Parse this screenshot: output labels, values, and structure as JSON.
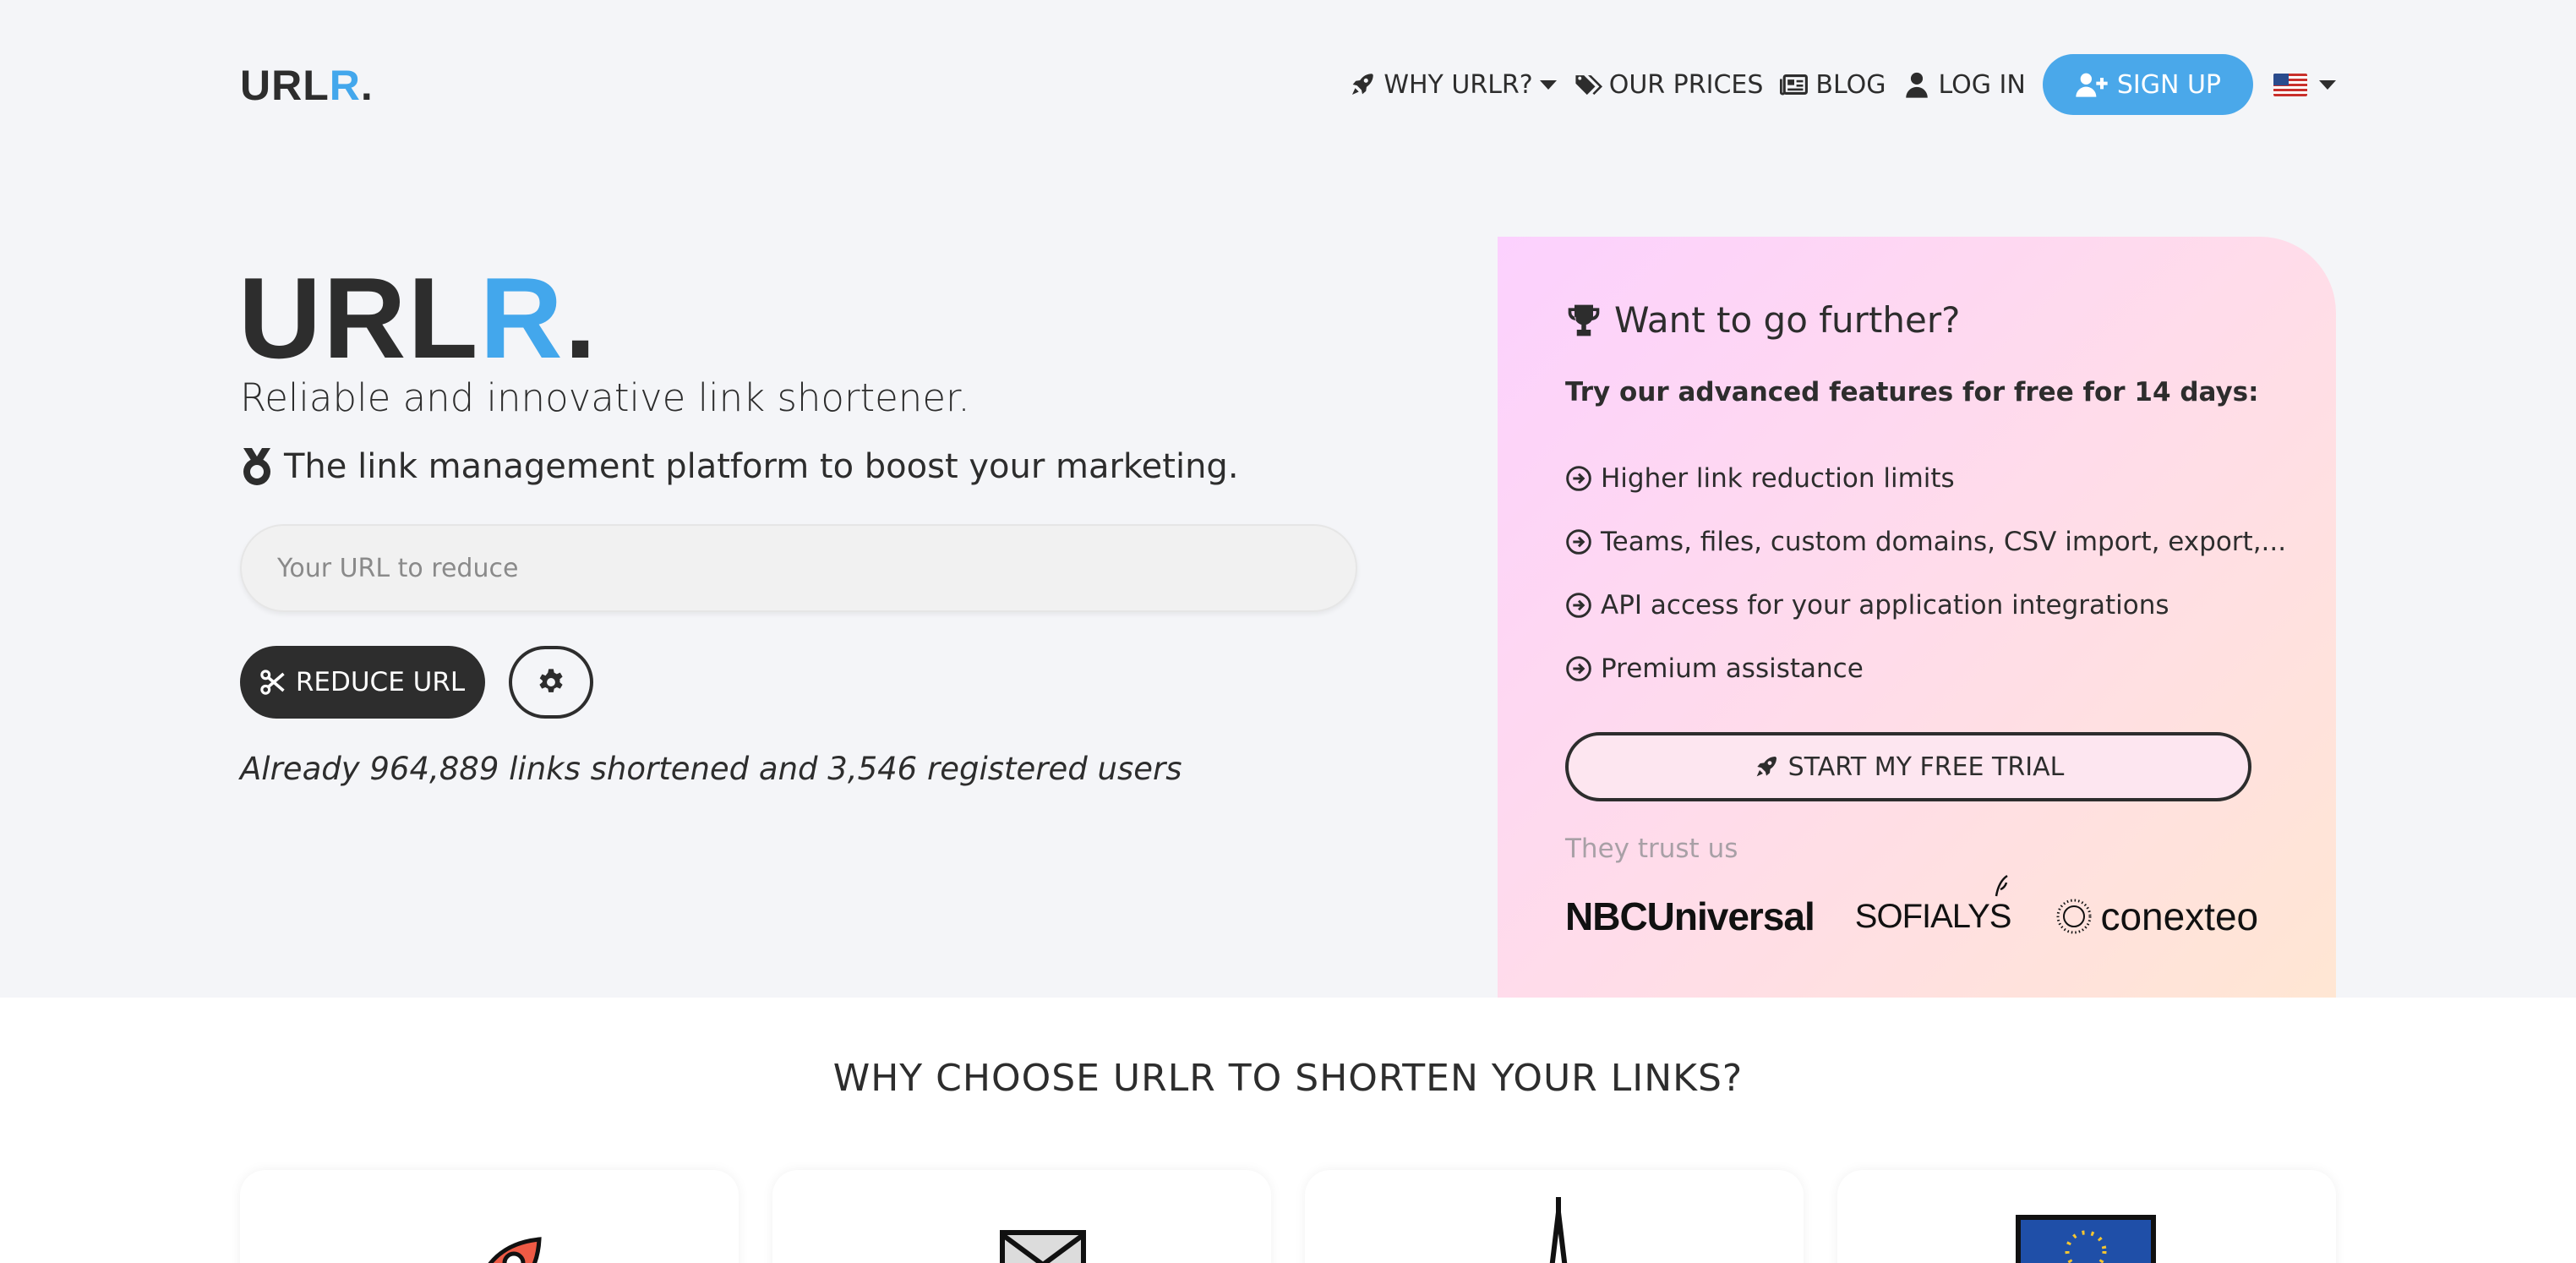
{
  "header": {
    "logo": {
      "text": "URL",
      "accent": "R",
      "dot": "."
    },
    "nav": [
      {
        "label": "WHY URLR?",
        "icon": "rocket-icon"
      },
      {
        "label": "OUR PRICES",
        "icon": "tags-icon"
      },
      {
        "label": "BLOG",
        "icon": "newspaper-icon"
      },
      {
        "label": "LOG IN",
        "icon": "user-icon"
      }
    ],
    "signup": {
      "label": "SIGN UP",
      "icon": "user-plus-icon"
    },
    "language": {
      "icon": "us-flag-icon"
    }
  },
  "hero": {
    "logo": {
      "text": "URL",
      "accent": "R",
      "dot": "."
    },
    "tagline": "Reliable and innovative link shortener.",
    "subtagline": "The link management platform to boost your marketing.",
    "url_input": {
      "placeholder": "Your URL to reduce",
      "value": ""
    },
    "reduce_button": "REDUCE URL",
    "stats": "Already 964,889 links shortened and 3,546 registered users"
  },
  "promo": {
    "title": "Want to go further?",
    "subtitle": "Try our advanced features for free for 14 days:",
    "features": [
      "Higher link reduction limits",
      "Teams, files, custom domains, CSV import, export,...",
      "API access for your application integrations",
      "Premium assistance"
    ],
    "trial_button": "START MY FREE TRIAL",
    "trust_label": "They trust us",
    "clients": [
      "NBCUniversal",
      "SOFIALYS",
      "conexteo"
    ]
  },
  "why_section": {
    "title": "WHY CHOOSE URLR TO SHORTEN YOUR LINKS?"
  },
  "colors": {
    "accent": "#43a7ec",
    "signup_bg": "#4aa8ea",
    "dark": "#2d2d2d",
    "background": "#f4f5f8"
  }
}
